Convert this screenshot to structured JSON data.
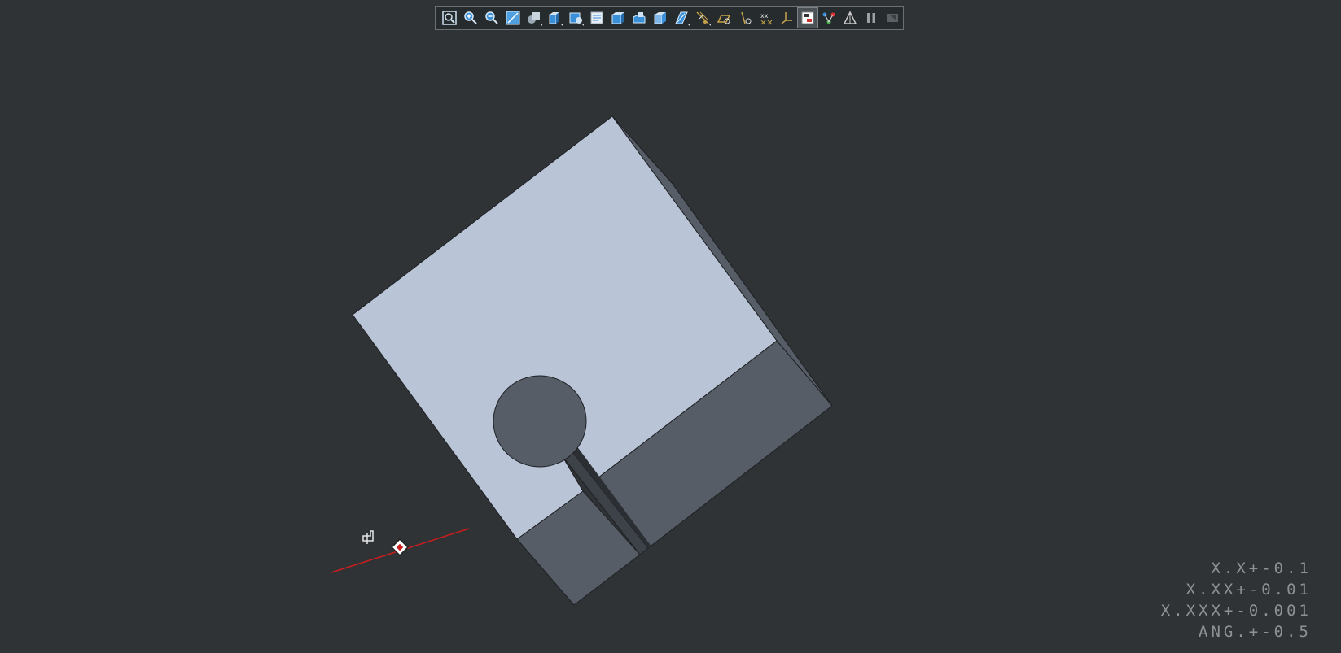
{
  "viewport": {
    "background": "#2f3335",
    "model_colors": {
      "top_face": "#b9c5d6",
      "side_face": "#575d67",
      "edge": "#1e2024",
      "axis_line": "#cc1d1d"
    }
  },
  "toolbar": {
    "buttons": [
      {
        "icon": "zoom-fit-icon",
        "name": "refit-button"
      },
      {
        "icon": "zoom-in-icon",
        "name": "zoom-in-button"
      },
      {
        "icon": "zoom-out-icon",
        "name": "zoom-out-button"
      },
      {
        "icon": "repaint-icon",
        "name": "repaint-button"
      },
      {
        "icon": "display-style-icon",
        "name": "display-style-button",
        "dropdown": true
      },
      {
        "icon": "saved-orientations-icon",
        "name": "saved-orientations-button",
        "dropdown": true
      },
      {
        "icon": "view-manager-icon",
        "name": "view-manager-button",
        "dropdown": true
      },
      {
        "icon": "section-icon",
        "name": "section-button"
      },
      {
        "icon": "appearance-icon",
        "name": "appearance-button"
      },
      {
        "icon": "perspective-icon",
        "name": "perspective-button"
      },
      {
        "icon": "cube-view-icon",
        "name": "cube-view-button"
      },
      {
        "icon": "plane-display-icon",
        "name": "plane-display-button",
        "dropdown": true
      },
      {
        "icon": "datum-display-icon",
        "name": "datum-display-button",
        "dropdown": true
      },
      {
        "icon": "sketch-display-icon",
        "name": "sketch-display-button"
      },
      {
        "icon": "axis-display-icon",
        "name": "axis-display-button"
      },
      {
        "icon": "point-display-icon",
        "name": "point-display-button"
      },
      {
        "icon": "csys-display-icon",
        "name": "csys-display-button"
      },
      {
        "icon": "annotation-display-icon",
        "name": "annotation-display-button",
        "active": true
      },
      {
        "icon": "spin-center-icon",
        "name": "spin-center-button"
      },
      {
        "icon": "simulation-icon",
        "name": "simulation-button"
      },
      {
        "icon": "pause-icon",
        "name": "pause-button"
      },
      {
        "icon": "disabled-icon",
        "name": "disabled-button"
      }
    ]
  },
  "tolerance_table": {
    "lines": [
      "X.X+-0.1",
      "X.XX+-0.01",
      "X.XXX+-0.001",
      "ANG.+-0.5"
    ]
  }
}
